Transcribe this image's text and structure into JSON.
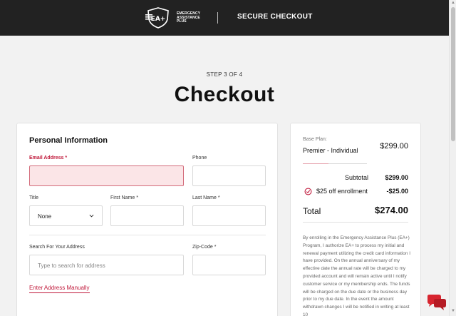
{
  "header": {
    "logo_mark": "EA+",
    "logo_line1": "EMERGENCY",
    "logo_line2": "ASSISTANCE",
    "logo_line3": "PLUS",
    "secure_label": "SECURE CHECKOUT"
  },
  "page": {
    "step": "STEP 3 OF 4",
    "title": "Checkout"
  },
  "personal": {
    "heading": "Personal Information",
    "email_label": "Email Address",
    "email_value": "",
    "phone_label": "Phone",
    "phone_value": "",
    "title_label": "Title",
    "title_value": "None",
    "first_name_label": "First Name",
    "first_name_value": "",
    "last_name_label": "Last Name",
    "last_name_value": "",
    "address_label": "Search For Your Address",
    "address_placeholder": "Type to search for address",
    "zip_label": "Zip-Code",
    "zip_value": "",
    "required_mark": "*",
    "manual_link": "Enter Address Manually"
  },
  "summary": {
    "base_plan_label": "Base Plan:",
    "plan_name": "Premier - Individual",
    "plan_price": "$299.00",
    "subtotal_label": "Subtotal",
    "subtotal_value": "$299.00",
    "discount_label": "$25 off enrollment",
    "discount_value": "-$25.00",
    "total_label": "Total",
    "total_value": "$274.00",
    "disclaimer": "By enrolling in the Emergency Assistance Plus (EA+) Program, I authorize EA+ to process my initial and renewal payment utilizing the credit card information I have provided. On the annual anniversary of my effective date the annual rate will be charged to my provided account and will remain active until I notify customer service or my membership ends. The funds will be charged on the due date or the business day prior to my due date. In the event the amount withdrawn changes I will be notified in writing at least 10"
  },
  "colors": {
    "header_bg": "#222222",
    "accent_red": "#c0183a",
    "error_bg": "#fbe5e7",
    "page_bg": "#f2f2f2"
  },
  "icons": {
    "logo": "shield-logo-icon",
    "select_chevron": "chevron-down-icon",
    "discount": "discount-tag-icon",
    "chat": "chat-bubbles-icon"
  }
}
